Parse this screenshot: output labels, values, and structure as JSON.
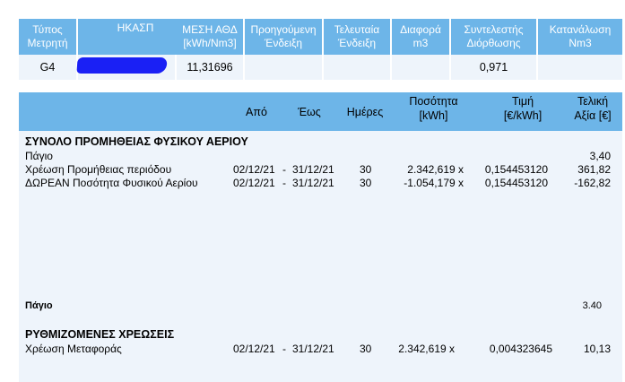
{
  "meter_table": {
    "headers": [
      {
        "line1": "Τύπος",
        "line2": "Μετρητή"
      },
      {
        "line1": "ΗΚΑΣΠ",
        "line2": ""
      },
      {
        "line1": "ΜΕΣΗ ΑΘΔ",
        "line2": "[kWh/Nm3]"
      },
      {
        "line1": "Προηγούμενη",
        "line2": "Ένδειξη"
      },
      {
        "line1": "Τελευταία",
        "line2": "Ένδειξη"
      },
      {
        "line1": "Διαφορά",
        "line2": "m3"
      },
      {
        "line1": "Συντελεστής",
        "line2": "Διόρθωσης"
      },
      {
        "line1": "Κατανάλωση",
        "line2": "Nm3"
      }
    ],
    "row": {
      "meter_type": "G4",
      "hkasp": "",
      "avg_gcv": "11,31696",
      "previous_reading": "",
      "last_reading": "",
      "difference": "",
      "correction_factor": "0,971",
      "consumption": ""
    }
  },
  "charges_table": {
    "headers": {
      "from": "Από",
      "to": "Έως",
      "days": "Ημέρες",
      "quantity_l1": "Ποσότητα",
      "quantity_l2": "[kWh]",
      "price_l1": "Τιμή",
      "price_l2": "[€/kWh]",
      "total_l1": "Τελική",
      "total_l2": "Αξία [€]"
    },
    "supply_section": {
      "title": "ΣΥΝΟΛΟ ΠΡΟΜΗΘΕΙΑΣ ΦΥΣΙΚΟΥ ΑΕΡΙΟΥ",
      "fixed_label": "Πάγιο",
      "fixed_value": "3,40",
      "rows": [
        {
          "desc": "Χρέωση Προμήθειας περιόδου",
          "from": "02/12/21",
          "dash": "-",
          "to": "31/12/21",
          "days": "30",
          "qty": "2.342,619 x",
          "price": "0,154453120",
          "total": "361,82"
        },
        {
          "desc": "ΔΩΡΕΑΝ Ποσότητα Φυσικού Αερίου",
          "from": "02/12/21",
          "dash": "-",
          "to": "31/12/21",
          "days": "30",
          "qty": "-1.054,179 x",
          "price": "0,154453120",
          "total": "-162,82"
        }
      ]
    },
    "fixed_total": {
      "label": "Πάγιο",
      "value": "3.40"
    },
    "regulated_section": {
      "title": "ΡΥΘΜΙΖΟΜΕΝΕΣ ΧΡΕΩΣΕΙΣ",
      "rows": [
        {
          "desc": "Χρέωση Μεταφοράς",
          "from": "02/12/21",
          "dash": "-",
          "to": "31/12/21",
          "days": "30",
          "qty": "2.342,619 x",
          "price": "0,004323645",
          "total": "10,13"
        }
      ]
    }
  }
}
